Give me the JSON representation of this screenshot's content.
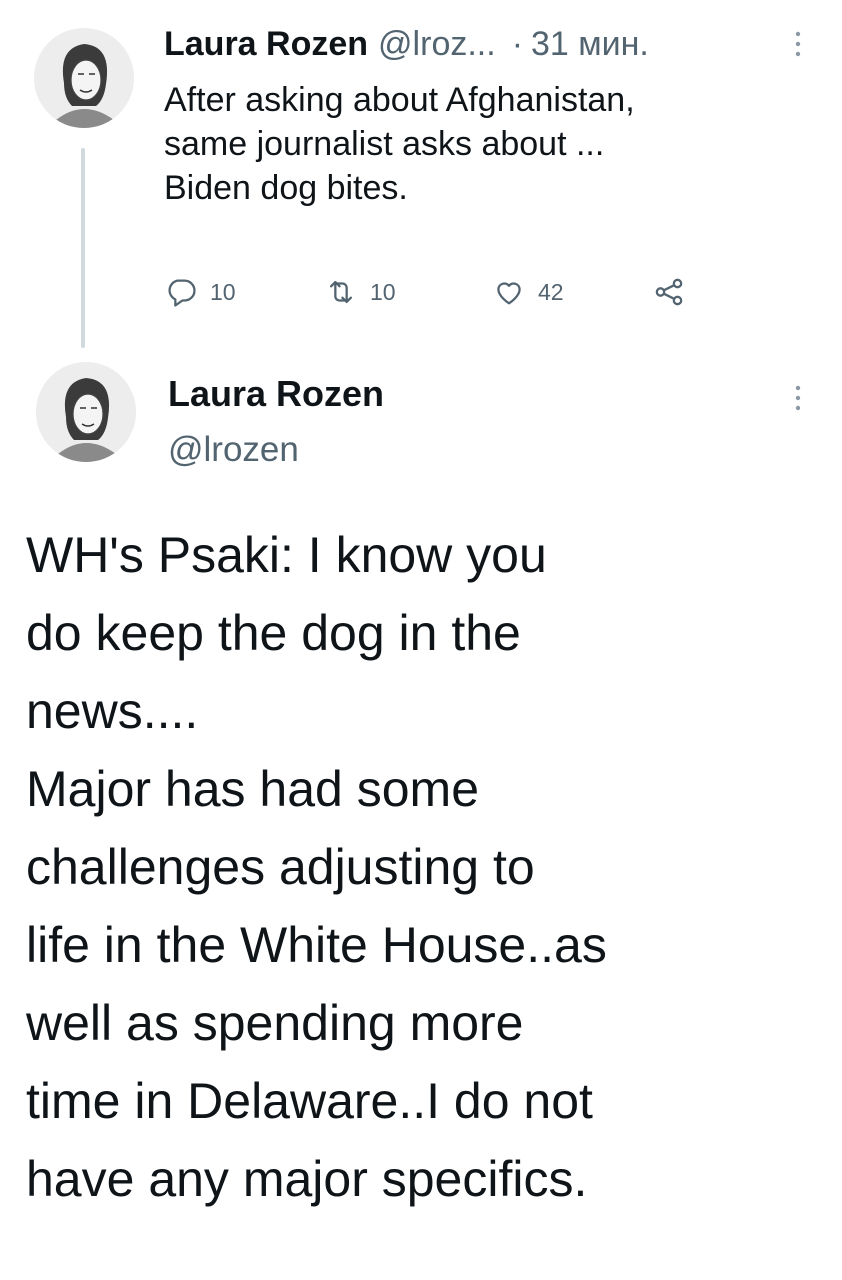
{
  "reply_tweet": {
    "author_name": "Laura Rozen",
    "handle": "@lroz...",
    "separator": "·",
    "time": "31 мин.",
    "text": "After asking about Afghanistan,\nsame journalist asks about ...\nBiden dog bites.",
    "actions": {
      "replies": "10",
      "retweets": "10",
      "likes": "42"
    }
  },
  "main_tweet": {
    "author_name": "Laura Rozen",
    "handle": "@lrozen",
    "text": "WH's Psaki: I know you\ndo keep the dog in the\nnews....\nMajor has had some\nchallenges adjusting to\nlife in the White House..as\nwell as spending more\ntime in Delaware..I do not\nhave any major specifics."
  },
  "icons": {
    "reply": "reply-icon",
    "retweet": "retweet-icon",
    "like": "like-icon",
    "share": "share-icon",
    "more": "more-vertical-icon"
  },
  "colors": {
    "text": "#0f1419",
    "secondary": "#536471",
    "thread_line": "#cfd9de"
  }
}
